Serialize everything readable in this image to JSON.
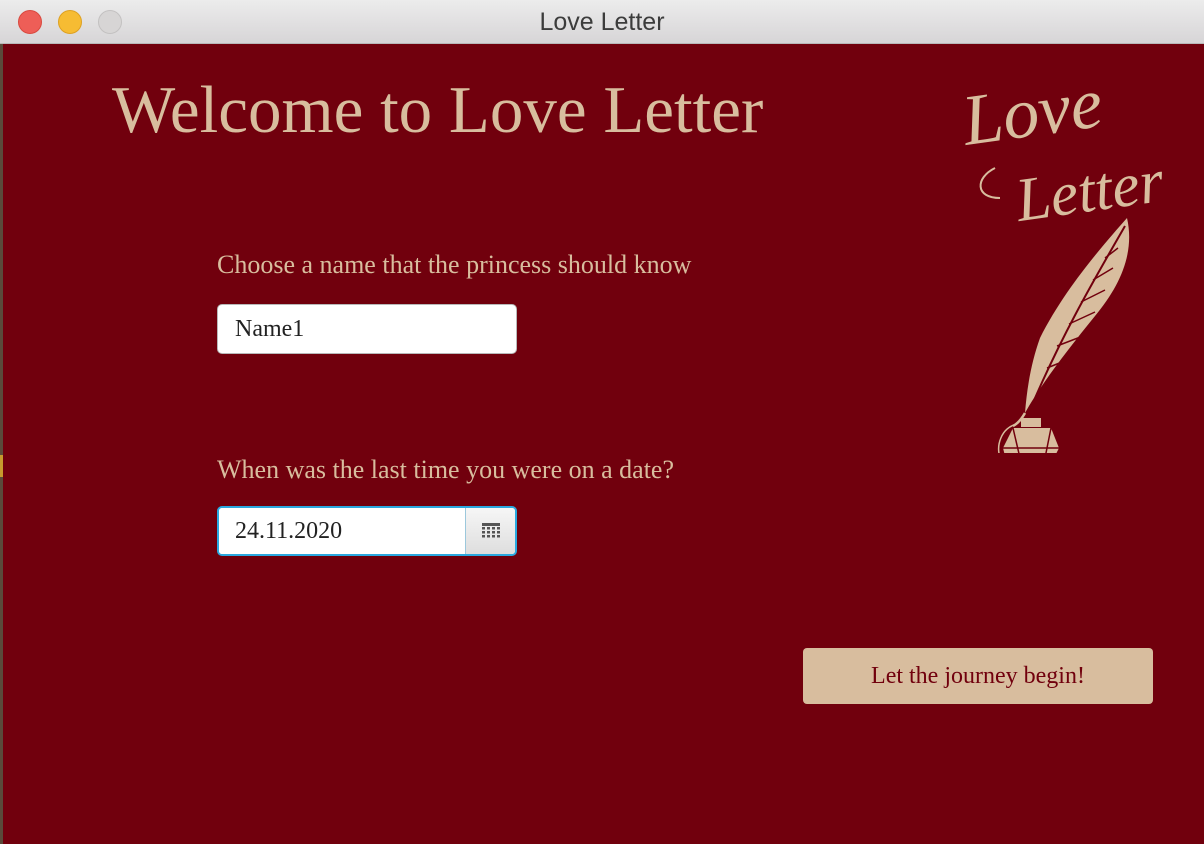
{
  "window": {
    "title": "Love Letter"
  },
  "main": {
    "heading": "Welcome to Love Letter",
    "name_label": "Choose a name that the princess should know",
    "name_value": "Name1",
    "date_label": "When was the last time you were on a date?",
    "date_value": "24.11.2020",
    "start_button": "Let the journey begin!"
  },
  "logo": {
    "line1": "Love",
    "line2": "Letter",
    "icon": "quill-and-inkwell-icon"
  },
  "colors": {
    "background": "#71000d",
    "accent": "#d8bd9e",
    "focus": "#2aa9e0"
  }
}
